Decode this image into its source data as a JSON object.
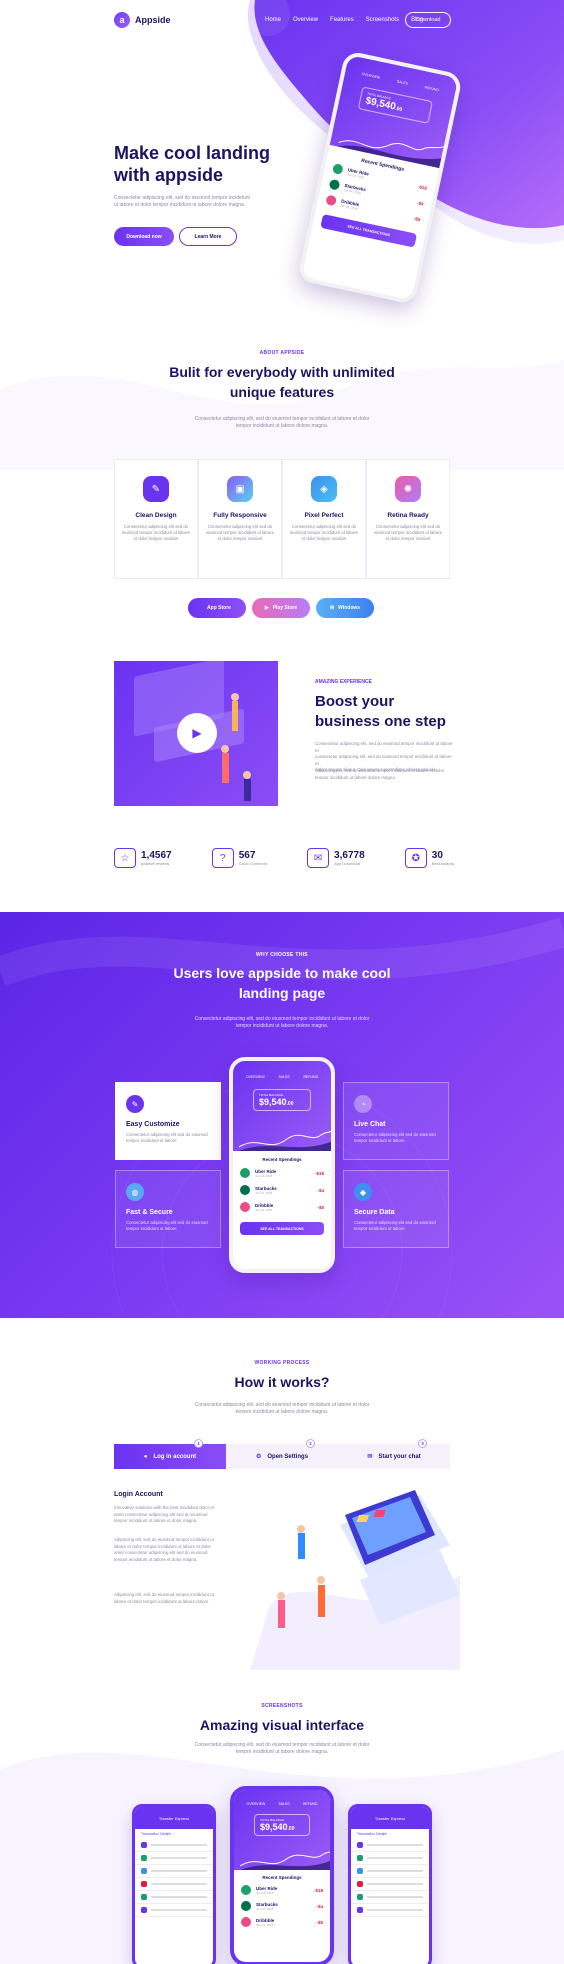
{
  "header": {
    "logo_glyph": "a",
    "brand": "Appside",
    "nav": [
      "Home",
      "Overview",
      "Features",
      "Screenshots",
      "Blog"
    ],
    "download": "Download"
  },
  "hero": {
    "title_line1": "Make cool landing",
    "title_line2": "with appside",
    "desc_line1": "Consectetur adipiscing elit, sed do eiusmod tempor incididunt",
    "desc_line2": "ut labore et dolor tempor incididunt ut labore dolore magna.",
    "btn_download": "Download now",
    "btn_learn": "Learn More"
  },
  "phone": {
    "tab_overview": "OVERVIEW",
    "tab_sales": "SALES",
    "tab_refund": "REFUND",
    "balance_label": "TOTAL BALANCE",
    "balance": "$9,540",
    "balance_cents": ".00",
    "recent": "Recent Spendings",
    "tx": [
      {
        "name": "Uber Ride",
        "date": "Jun 04, 2018",
        "amount": "-$18",
        "color": "#1e9e6a"
      },
      {
        "name": "Starbucks",
        "date": "Jun 04, 2018",
        "amount": "-$4",
        "color": "#00704a"
      },
      {
        "name": "Dribbble",
        "date": "Jun 04, 2018",
        "amount": "-$5",
        "color": "#ea4c89"
      }
    ],
    "see_all": "SEE ALL TRANSACTIONS"
  },
  "about": {
    "eyebrow": "ABOUT APPSIDE",
    "title_line1": "Bulit for everybody with unlimited",
    "title_line2": "unique features",
    "desc_line1": "Consectetur adipiscing elit, sed do eiusmod tempor incididunt ut labore et dolor",
    "desc_line2": "tempor incididunt ut labore dolore magna.",
    "features": [
      {
        "title": "Clean Design",
        "desc": "Consectetur adipiscing elit sed do eiusmod tempor incididunt ut labore et dolor tempor incidunt",
        "color": "#6a33f0"
      },
      {
        "title": "Fully Responsive",
        "desc": "Consectetur adipiscing elit sed do eiusmod tempor incididunt ut labore et dolor tempor incidunt",
        "color": "#5aa8f2"
      },
      {
        "title": "Pixel Perfect",
        "desc": "Consectetur adipiscing elit sed do eiusmod tempor incididunt ut labore et dolor tempor incidunt",
        "color": "#3d8ff0"
      },
      {
        "title": "Retina Ready",
        "desc": "Consectetur adipiscing elit sed do eiusmod tempor incididunt ut labore et dolor tempor incidunt",
        "color": "#e85ca8"
      }
    ],
    "stores": [
      "App Store",
      "Play Store",
      "Windows"
    ]
  },
  "experience": {
    "eyebrow": "AMAZING EXPERIENCE",
    "title_line1": "Boost your",
    "title_line2": "business one step",
    "p1_line1": "Consectetur adipiscing elit, sed do eiusmod tempor incididunt ut labore et",
    "p1_line2": "consectetur adipiscing elit, sed do eiusmod tempor incididunt ut labore et",
    "p1_line3": "dolore magna aliqua. Quis ipsum suspendisse ultrices gravida.",
    "p2_line1": "Adipiscing elit, sed do eiusmod tempor incididunt ut labore et dolor",
    "p2_line2": "tempor incididunt ut labore dolore magna."
  },
  "stats": [
    {
      "num": "1,4567",
      "label": "positive reviews",
      "icon": "stars-icon"
    },
    {
      "num": "567",
      "label": "Good Comment",
      "icon": "chat-icon"
    },
    {
      "num": "3,6778",
      "label": "App Download",
      "icon": "mail-icon"
    },
    {
      "num": "30",
      "label": "Best Awards",
      "icon": "award-icon"
    }
  ],
  "why": {
    "eyebrow": "WHY CHOOSE THIS",
    "title_line1": "Users love appside to make cool",
    "title_line2": "landing page",
    "desc_line1": "Consectetur adipiscing elit, sed do eiusmod tempor incididunt ut labore et dolor",
    "desc_line2": "tempor incididunt ut labore dolore magna.",
    "cards": [
      {
        "title": "Easy Customize",
        "desc": "Consectetur adipiscing elit sed do eiusmod tempor incididunt ut labore"
      },
      {
        "title": "Live Chat",
        "desc": "Consectetur adipiscing elit sed do eiusmod tempor incididunt ut labore"
      },
      {
        "title": "Fast & Secure",
        "desc": "Consectetur adipiscing elit sed do eiusmod tempor incididunt ut labore"
      },
      {
        "title": "Secure Data",
        "desc": "Consectetur adipiscing elit sed do eiusmod tempor incididunt ut labore"
      }
    ]
  },
  "how": {
    "eyebrow": "WORKING PROCESS",
    "title": "How it works?",
    "desc_line1": "Consectetur adipiscing elit, sed do eiusmod tempor incididunt ut labore et dolor",
    "desc_line2": "tempor incididunt ut labore dolore magna.",
    "tabs": [
      {
        "num": "1",
        "label": "Log in account"
      },
      {
        "num": "2",
        "label": "Open Settings"
      },
      {
        "num": "3",
        "label": "Start your chat"
      }
    ],
    "login_title": "Login Account",
    "p1_line1": "Innovative solutions with the best incididunt dolor et",
    "p1_line2": "amet consectetur adipiscing elit sed do eiusmod",
    "p1_line3": "tempor incididunt ut labore et dolor magna.",
    "p2_line1": "Adipiscing elit, sed do eiusmod tempor incididunt ut",
    "p2_line2": "labore et dolor tempor incididunt ut labore et dolor",
    "p2_line3": "amet consectetur adipiscing elit sed do eiusmod",
    "p2_line4": "tempor incididunt ut labore et dolor magna.",
    "p3_line1": "Adipiscing elit, sed do eiusmod tempor incididunt ut",
    "p3_line2": "labore et dolor tempor incididunt ut labore dolore"
  },
  "shots": {
    "eyebrow": "SCREENSHOTS",
    "title": "Amazing visual interface",
    "desc_line1": "Consectetur adipiscing elit, sed do eiusmod tempor incididunt ut labore et dolor",
    "desc_line2": "tempor incididunt ut labore dolore magna.",
    "side_title": "Transfer Express",
    "side_sub": "Transaction Details"
  }
}
